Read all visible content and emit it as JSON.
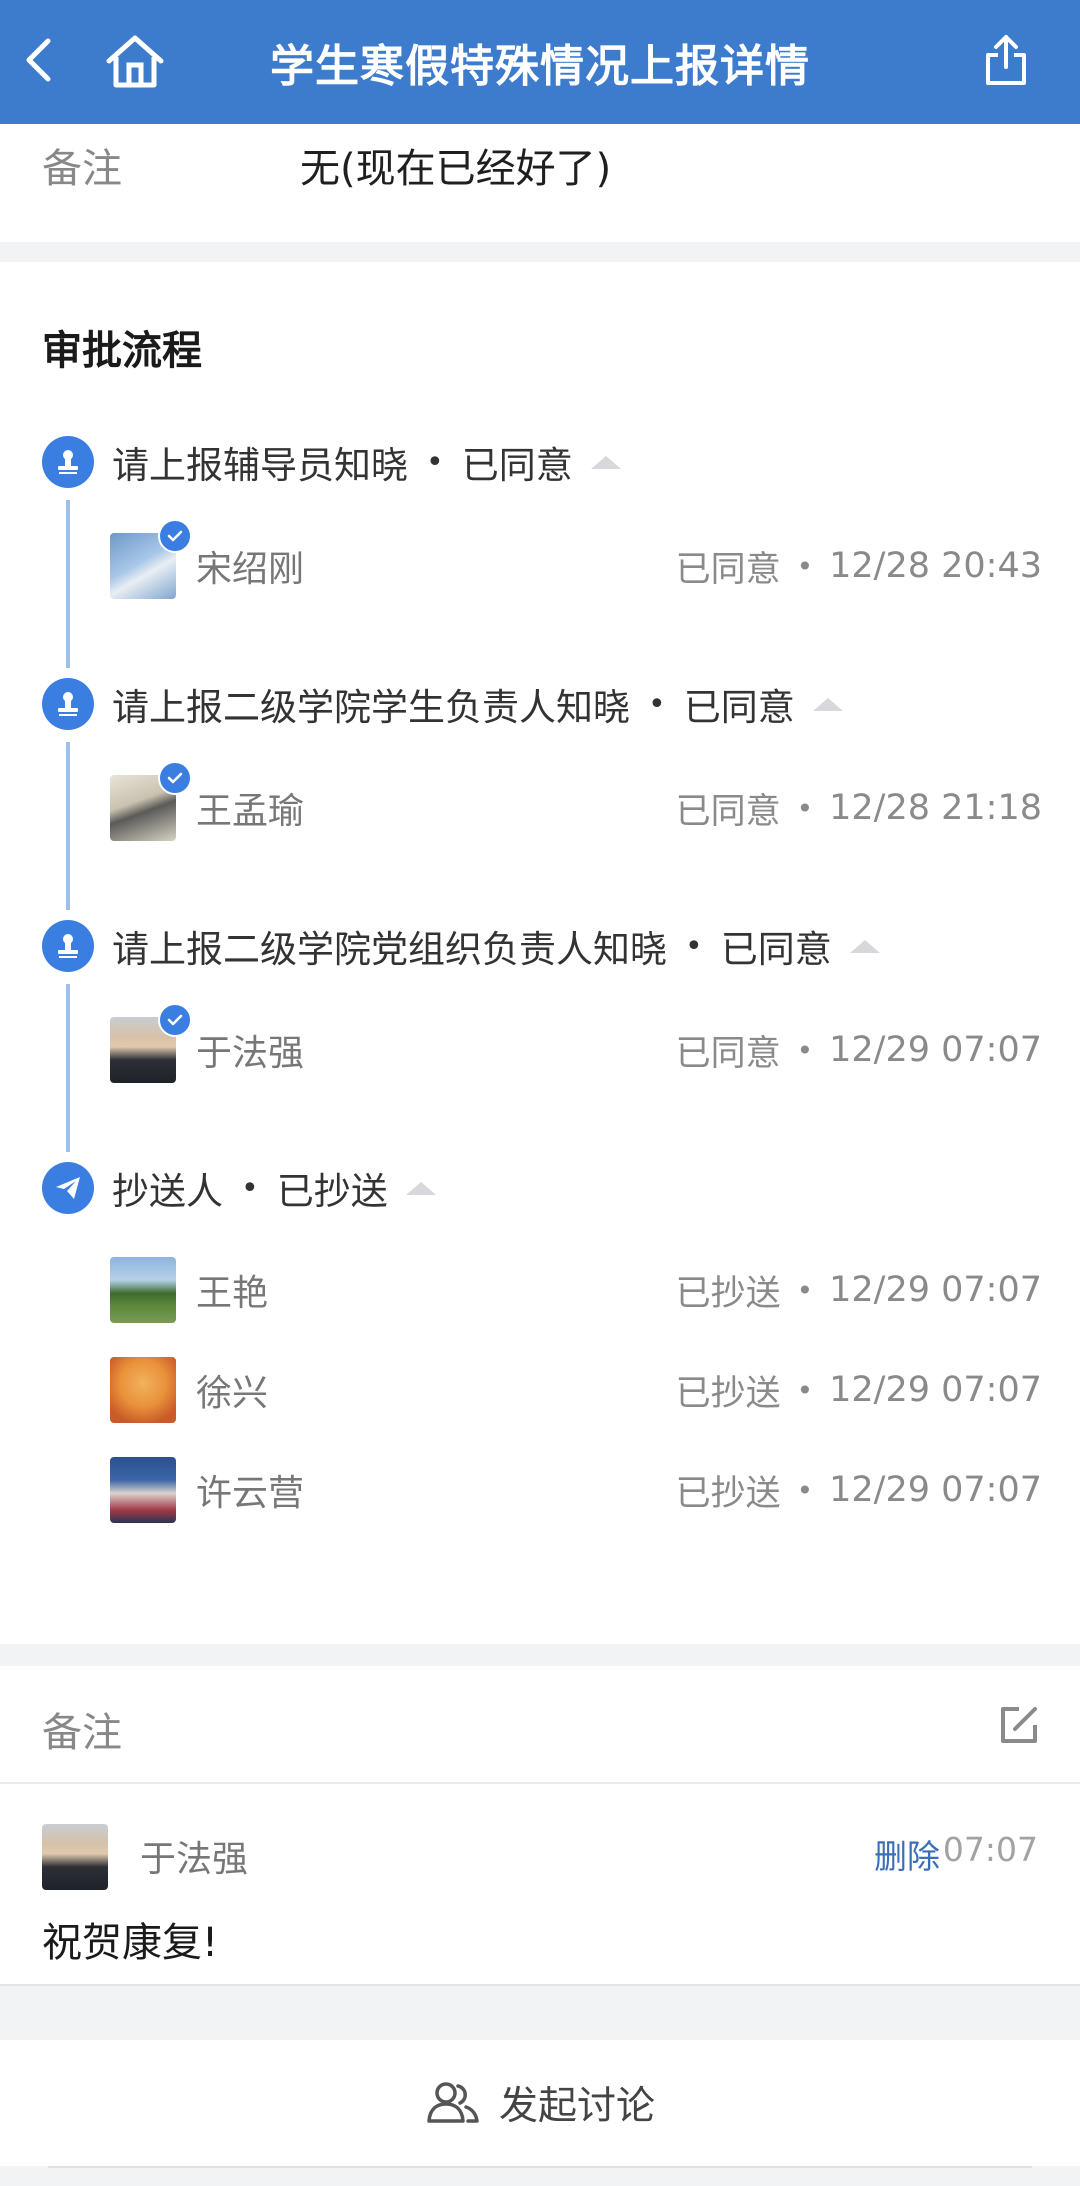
{
  "header": {
    "title": "学生寒假特殊情况上报详情",
    "icons": [
      "chevron-left-icon",
      "home-icon",
      "share-icon"
    ]
  },
  "top_card": {
    "label": "备注",
    "value": "无(现在已经好了)"
  },
  "flow": {
    "title": "审批流程",
    "steps": [
      {
        "label": "请上报辅导员知晓",
        "status": "已同意",
        "icon": "stamp-icon",
        "people": [
          {
            "name": "宋绍刚",
            "status": "已同意",
            "time": "12/28 20:43",
            "checked": true
          }
        ]
      },
      {
        "label": "请上报二级学院学生负责人知晓",
        "status": "已同意",
        "icon": "stamp-icon",
        "people": [
          {
            "name": "王孟瑜",
            "status": "已同意",
            "time": "12/28 21:18",
            "checked": true
          }
        ]
      },
      {
        "label": "请上报二级学院党组织负责人知晓",
        "status": "已同意",
        "icon": "stamp-icon",
        "people": [
          {
            "name": "于法强",
            "status": "已同意",
            "time": "12/29 07:07",
            "checked": true
          }
        ]
      },
      {
        "label": "抄送人",
        "status": "已抄送",
        "icon": "send-icon",
        "people": [
          {
            "name": "王艳",
            "status": "已抄送",
            "time": "12/29 07:07",
            "checked": false
          },
          {
            "name": "徐兴",
            "status": "已抄送",
            "time": "12/29 07:07",
            "checked": false
          },
          {
            "name": "许云营",
            "status": "已抄送",
            "time": "12/29 07:07",
            "checked": false
          }
        ]
      }
    ]
  },
  "remark": {
    "label": "备注",
    "comment": {
      "name": "于法强",
      "delete_label": "删除",
      "time": "07:07",
      "text": "祝贺康复!"
    }
  },
  "discuss": {
    "label": "发起讨论"
  },
  "colors": {
    "header_bg": "#3d7ccd",
    "accent": "#3a7ee2",
    "timeline": "#9fbfe6",
    "link": "#3a6fb6"
  }
}
